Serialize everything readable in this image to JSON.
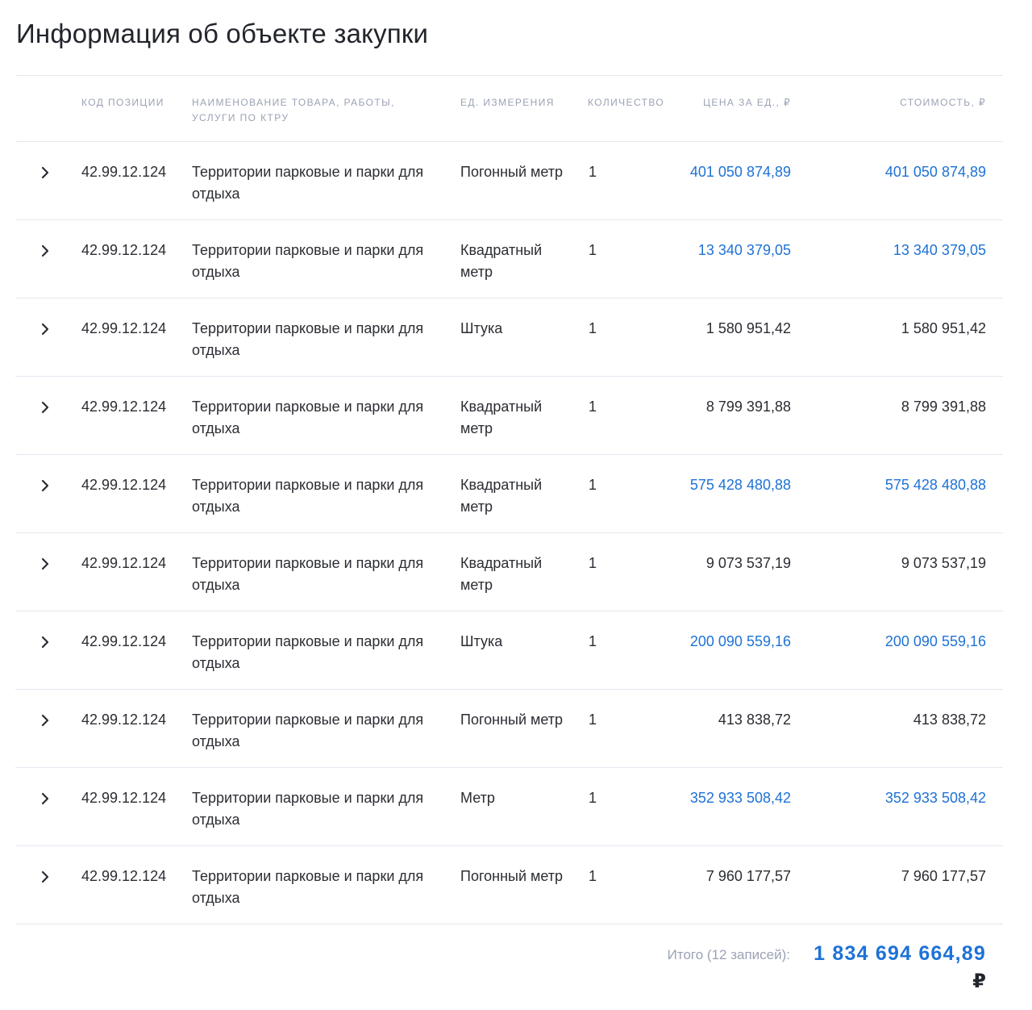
{
  "page": {
    "title": "Информация об объекте закупки"
  },
  "table": {
    "headers": {
      "code": "КОД ПОЗИЦИИ",
      "name": "НАИМЕНОВАНИЕ ТОВАРА, РАБОТЫ, УСЛУГИ ПО КТРУ",
      "unit": "ЕД. ИЗМЕРЕНИЯ",
      "qty": "КОЛИЧЕСТВО",
      "price": "ЦЕНА ЗА ЕД., ₽",
      "total": "СТОИМОСТЬ, ₽"
    },
    "rows": [
      {
        "code": "42.99.12.124",
        "name": "Территории парковые и парки для отдыха",
        "unit": "Погонный метр",
        "qty": "1",
        "price": "401 050 874,89",
        "total": "401 050 874,89",
        "highlight": true
      },
      {
        "code": "42.99.12.124",
        "name": "Территории парковые и парки для отдыха",
        "unit": "Квадратный метр",
        "qty": "1",
        "price": "13 340 379,05",
        "total": "13 340 379,05",
        "highlight": true
      },
      {
        "code": "42.99.12.124",
        "name": "Территории парковые и парки для отдыха",
        "unit": "Штука",
        "qty": "1",
        "price": "1 580 951,42",
        "total": "1 580 951,42",
        "highlight": false
      },
      {
        "code": "42.99.12.124",
        "name": "Территории парковые и парки для отдыха",
        "unit": "Квадратный метр",
        "qty": "1",
        "price": "8 799 391,88",
        "total": "8 799 391,88",
        "highlight": false
      },
      {
        "code": "42.99.12.124",
        "name": "Территории парковые и парки для отдыха",
        "unit": "Квадратный метр",
        "qty": "1",
        "price": "575 428 480,88",
        "total": "575 428 480,88",
        "highlight": true
      },
      {
        "code": "42.99.12.124",
        "name": "Территории парковые и парки для отдыха",
        "unit": "Квадратный метр",
        "qty": "1",
        "price": "9 073 537,19",
        "total": "9 073 537,19",
        "highlight": false
      },
      {
        "code": "42.99.12.124",
        "name": "Территории парковые и парки для отдыха",
        "unit": "Штука",
        "qty": "1",
        "price": "200 090 559,16",
        "total": "200 090 559,16",
        "highlight": true
      },
      {
        "code": "42.99.12.124",
        "name": "Территории парковые и парки для отдыха",
        "unit": "Погонный метр",
        "qty": "1",
        "price": "413 838,72",
        "total": "413 838,72",
        "highlight": false
      },
      {
        "code": "42.99.12.124",
        "name": "Территории парковые и парки для отдыха",
        "unit": "Метр",
        "qty": "1",
        "price": "352 933 508,42",
        "total": "352 933 508,42",
        "highlight": true
      },
      {
        "code": "42.99.12.124",
        "name": "Территории парковые и парки для отдыха",
        "unit": "Погонный метр",
        "qty": "1",
        "price": "7 960 177,57",
        "total": "7 960 177,57",
        "highlight": false
      }
    ]
  },
  "summary": {
    "label": "Итого (12 записей):",
    "value": "1 834 694 664,89",
    "currency": "₽"
  },
  "colors": {
    "link": "#1e72d6",
    "text": "#2b2d33",
    "muted": "#9aa2b3",
    "divider": "#e3e7ef"
  },
  "icons": {
    "expand": "chevron-right-icon"
  }
}
